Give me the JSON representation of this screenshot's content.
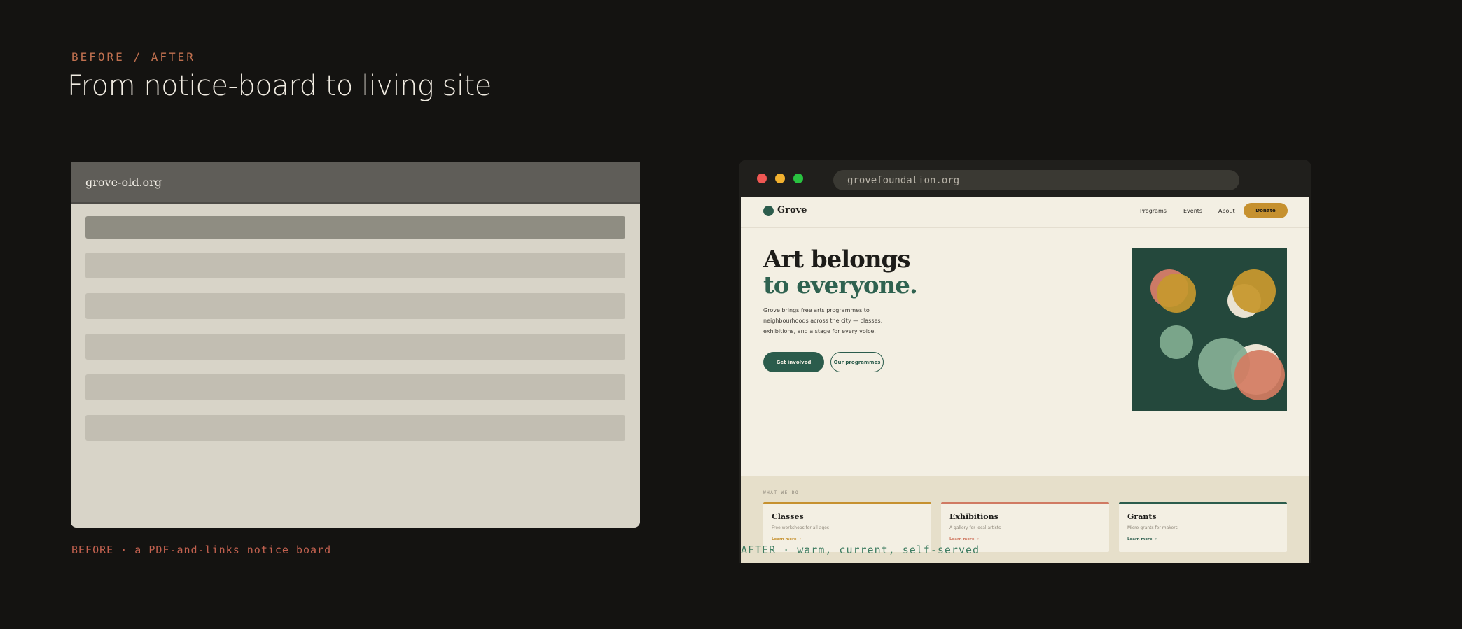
{
  "header": {
    "eyebrow": "BEFORE / AFTER",
    "title": "From notice-board to living site"
  },
  "before": {
    "url": "grove-old.org",
    "caption": "BEFORE · a PDF-and-links notice board"
  },
  "after": {
    "url": "grovefoundation.org",
    "caption": "AFTER · warm, current, self-served",
    "site": {
      "logo": "Grove",
      "nav": [
        "Programs",
        "Events",
        "About"
      ],
      "donate": "Donate",
      "headline_line1": "Art belongs",
      "headline_line2": "to everyone.",
      "description": "Grove brings free arts programmes to neighbourhoods across the city — classes, exhibitions, and a stage for every voice.",
      "primary_cta": "Get involved",
      "secondary_cta": "Our programmes",
      "section_label": "WHAT WE DO",
      "cards": [
        {
          "title": "Classes",
          "desc": "Free workshops for all ages",
          "link": "Learn more →",
          "accent": "#c6912f"
        },
        {
          "title": "Exhibitions",
          "desc": "A gallery for local artists",
          "link": "Learn more →",
          "accent": "#d07a63"
        },
        {
          "title": "Grants",
          "desc": "Micro-grants for makers",
          "link": "Learn more →",
          "accent": "#2b5c4c"
        }
      ]
    }
  },
  "colors": {
    "background": "#141311",
    "brand_green": "#2b5c4c",
    "gold": "#c6912f",
    "coral": "#d07a63",
    "cream": "#f3efe3"
  }
}
